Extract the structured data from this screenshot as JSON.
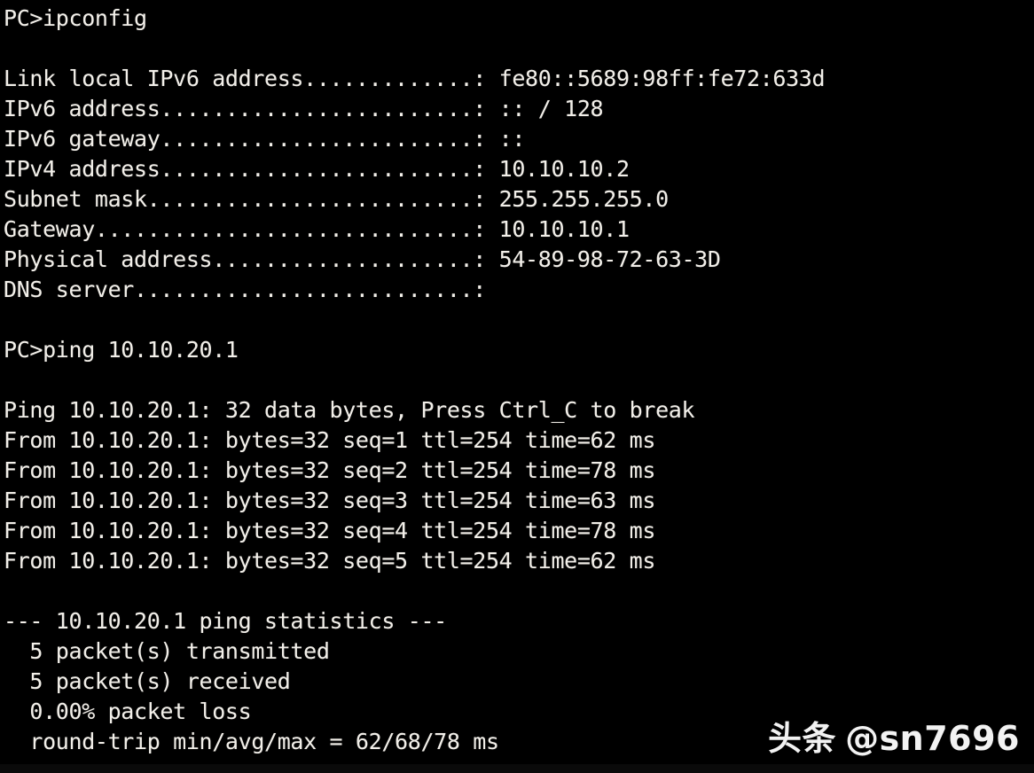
{
  "terminal": {
    "background_color": "#000000",
    "text_color": "#f2efe9",
    "prompt": "PC>",
    "lines": [
      "PC>ipconfig",
      "",
      "Link local IPv6 address.............: fe80::5689:98ff:fe72:633d",
      "IPv6 address........................: :: / 128",
      "IPv6 gateway........................: ::",
      "IPv4 address........................: 10.10.10.2",
      "Subnet mask.........................: 255.255.255.0",
      "Gateway.............................: 10.10.10.1",
      "Physical address....................: 54-89-98-72-63-3D",
      "DNS server..........................:",
      "",
      "PC>ping 10.10.20.1",
      "",
      "Ping 10.10.20.1: 32 data bytes, Press Ctrl_C to break",
      "From 10.10.20.1: bytes=32 seq=1 ttl=254 time=62 ms",
      "From 10.10.20.1: bytes=32 seq=2 ttl=254 time=78 ms",
      "From 10.10.20.1: bytes=32 seq=3 ttl=254 time=63 ms",
      "From 10.10.20.1: bytes=32 seq=4 ttl=254 time=78 ms",
      "From 10.10.20.1: bytes=32 seq=5 ttl=254 time=62 ms",
      "",
      "--- 10.10.20.1 ping statistics ---",
      "  5 packet(s) transmitted",
      "  5 packet(s) received",
      "  0.00% packet loss",
      "  round-trip min/avg/max = 62/68/78 ms"
    ],
    "commands": [
      "ipconfig",
      "ping 10.10.20.1"
    ],
    "ipconfig": {
      "link_local_ipv6_address_label": "Link local IPv6 address",
      "link_local_ipv6_address": "fe80::5689:98ff:fe72:633d",
      "ipv6_address_label": "IPv6 address",
      "ipv6_address": ":: / 128",
      "ipv6_gateway_label": "IPv6 gateway",
      "ipv6_gateway": "::",
      "ipv4_address_label": "IPv4 address",
      "ipv4_address": "10.10.10.2",
      "subnet_mask_label": "Subnet mask",
      "subnet_mask": "255.255.255.0",
      "gateway_label": "Gateway",
      "gateway": "10.10.10.1",
      "physical_address_label": "Physical address",
      "physical_address": "54-89-98-72-63-3D",
      "dns_server_label": "DNS server",
      "dns_server": ""
    },
    "ping": {
      "target": "10.10.20.1",
      "header": "Ping 10.10.20.1: 32 data bytes, Press Ctrl_C to break",
      "data_bytes": "32",
      "break_key": "Ctrl_C",
      "replies": [
        {
          "from": "10.10.20.1",
          "bytes": "32",
          "seq": "1",
          "ttl": "254",
          "time": "62",
          "unit": "ms"
        },
        {
          "from": "10.10.20.1",
          "bytes": "32",
          "seq": "2",
          "ttl": "254",
          "time": "78",
          "unit": "ms"
        },
        {
          "from": "10.10.20.1",
          "bytes": "32",
          "seq": "3",
          "ttl": "254",
          "time": "63",
          "unit": "ms"
        },
        {
          "from": "10.10.20.1",
          "bytes": "32",
          "seq": "4",
          "ttl": "254",
          "time": "78",
          "unit": "ms"
        },
        {
          "from": "10.10.20.1",
          "bytes": "32",
          "seq": "5",
          "ttl": "254",
          "time": "62",
          "unit": "ms"
        }
      ],
      "statistics": {
        "heading": "--- 10.10.20.1 ping statistics ---",
        "transmitted": "  5 packet(s) transmitted",
        "received": "  5 packet(s) received",
        "loss": "  0.00% packet loss",
        "round_trip": "  round-trip min/avg/max = 62/68/78 ms",
        "packets_transmitted": "5",
        "packets_received": "5",
        "packet_loss_percent": "0.00%",
        "rtt_min": "62",
        "rtt_avg": "68",
        "rtt_max": "78",
        "rtt_unit": "ms"
      }
    }
  },
  "watermark": {
    "logo": "头条",
    "handle": "@sn7696"
  }
}
